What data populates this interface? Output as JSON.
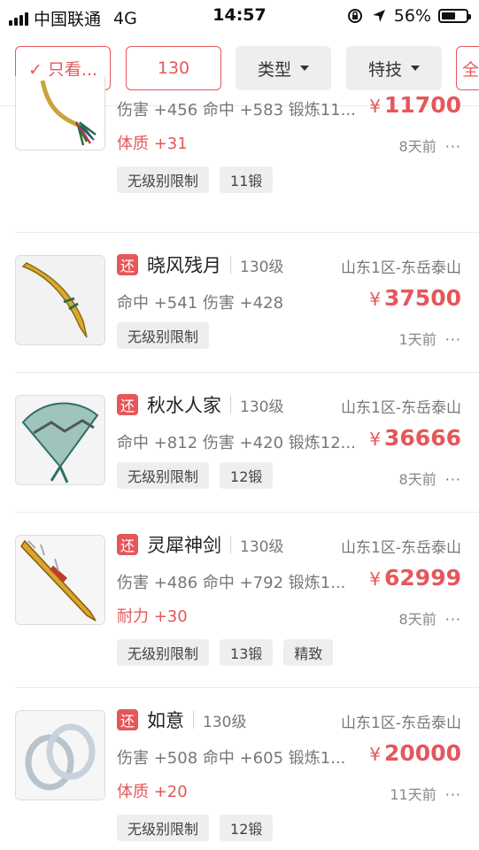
{
  "status_bar": {
    "carrier": "中国联通",
    "network": "4G",
    "time": "14:57",
    "battery": "56%",
    "battery_level": 0.56
  },
  "filters": {
    "only_label": "✓ 只看...",
    "level_value": "130",
    "type_label": "类型",
    "skill_label": "特技",
    "all_label": "全"
  },
  "colors": {
    "accent": "#e5575a"
  },
  "items": [
    {
      "name": "",
      "level": "",
      "server": "",
      "attrs": "伤害 +456 命中 +583 锻炼11...",
      "price_symbol": "¥",
      "price": "11700",
      "extra": "体质 +31",
      "time": "8天前",
      "more": "···",
      "tags": [
        "无级别限制",
        "11锻"
      ]
    },
    {
      "badge": "还",
      "name": "晓风残月",
      "level": "130级",
      "server": "山东1区-东岳泰山",
      "attrs": "命中 +541 伤害 +428",
      "price_symbol": "¥",
      "price": "37500",
      "time": "1天前",
      "more": "···",
      "tags": [
        "无级别限制"
      ]
    },
    {
      "badge": "还",
      "name": "秋水人家",
      "level": "130级",
      "server": "山东1区-东岳泰山",
      "attrs": "命中 +812 伤害 +420 锻炼12...",
      "price_symbol": "¥",
      "price": "36666",
      "time": "8天前",
      "more": "···",
      "tags": [
        "无级别限制",
        "12锻"
      ]
    },
    {
      "badge": "还",
      "name": "灵犀神剑",
      "level": "130级",
      "server": "山东1区-东岳泰山",
      "attrs": "伤害 +486 命中 +792 锻炼1...",
      "price_symbol": "¥",
      "price": "62999",
      "extra": "耐力 +30",
      "time": "8天前",
      "more": "···",
      "tags": [
        "无级别限制",
        "13锻",
        "精致"
      ]
    },
    {
      "badge": "还",
      "name": "如意",
      "level": "130级",
      "server": "山东1区-东岳泰山",
      "attrs": "伤害 +508 命中 +605 锻炼1...",
      "price_symbol": "¥",
      "price": "20000",
      "extra": "体质 +20",
      "time": "11天前",
      "more": "···",
      "tags": [
        "无级别限制",
        "12锻"
      ]
    }
  ],
  "icons": {
    "signal": "signal-bars-icon",
    "lock": "orientation-lock-icon",
    "location": "location-arrow-icon",
    "battery": "battery-icon",
    "dropdown": "triangle-down-icon",
    "more": "more-dots-icon"
  }
}
